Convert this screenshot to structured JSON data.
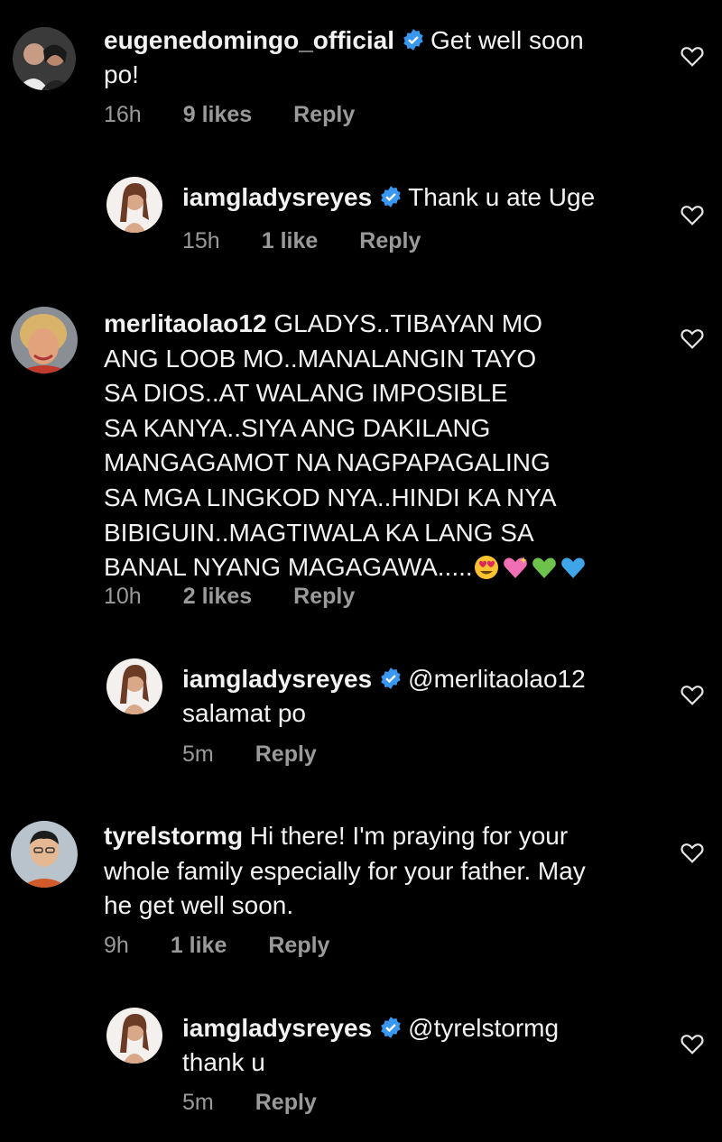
{
  "comments": [
    {
      "username": "eugenedomingo_official",
      "text": "Get well soon po!",
      "text_line1": "Get well soon",
      "text_line2": "po!",
      "time": "16h",
      "likes": "9 likes",
      "reply": "Reply"
    },
    {
      "username": "iamgladysreyes",
      "text": "Thank u ate Uge",
      "time": "15h",
      "likes": "1 like",
      "reply": "Reply"
    },
    {
      "username": "merlitaolao12",
      "text_lines": [
        "GLADYS..TIBAYAN MO",
        "ANG LOOB MO..MANALANGIN  TAYO",
        "SA DIOS..AT WALANG IMPOSIBLE",
        "SA KANYA..SIYA ANG DAKILANG",
        "MANGAGAMOT NA NAGPAPAGALING",
        "SA MGA LINGKOD NYA..HINDI KA NYA",
        "BIBIGUIN..MAGTIWALA KA LANG SA",
        "BANAL NYANG MAGAGAWA....."
      ],
      "emojis": [
        "heart-eyes-emoji",
        "sparkling-heart-emoji",
        "green-heart-emoji",
        "blue-heart-emoji"
      ],
      "time": "10h",
      "likes": "2 likes",
      "reply": "Reply"
    },
    {
      "username": "iamgladysreyes",
      "text_line1": "@merlitaolao12",
      "text_line2": "salamat po",
      "time": "5m",
      "reply": "Reply"
    },
    {
      "username": "tyrelstormg",
      "text_lines": [
        "Hi there! I'm praying for your",
        "whole family especially for your father. May",
        "he get well soon."
      ],
      "time": "9h",
      "likes": "1 like",
      "reply": "Reply"
    },
    {
      "username": "iamgladysreyes",
      "text_line1": "@tyrelstormg",
      "text_line2": "thank u",
      "time": "5m",
      "reply": "Reply"
    }
  ],
  "colors": {
    "background": "#000000",
    "text": "#f2f2f2",
    "meta": "#9a9a9a",
    "verified": "#3897f0"
  }
}
